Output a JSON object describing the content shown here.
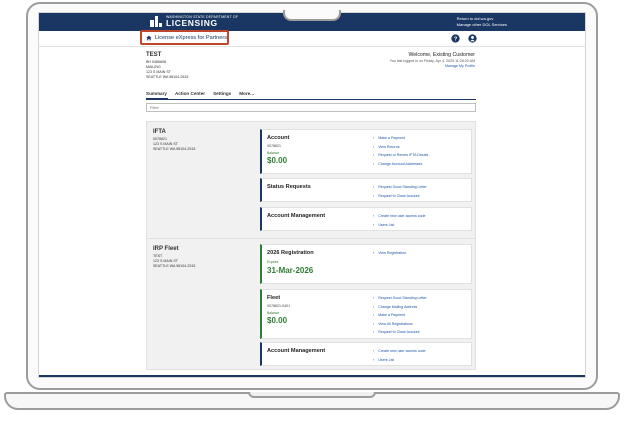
{
  "header": {
    "brand_small": "WASHINGTON STATE DEPARTMENT OF",
    "brand_big": "LICENSING",
    "link_return": "Return to dol.wa.gov",
    "link_other": "Manage other DOL Services"
  },
  "subheader": {
    "product_name": "License eXpress for Partners"
  },
  "customer": {
    "name": "TEST",
    "id": "BH 0466698",
    "line1": "MAILING",
    "line2": "123 S MAIN ST",
    "line3": "SEATTLE WA 98104-2515"
  },
  "welcome": {
    "title": "Welcome, Existing Customer",
    "last_login": "You last logged in on Friday, Apr 4, 2025 11:28:20 AM",
    "manage_profile": "Manage My Profile"
  },
  "tabs": [
    "Summary",
    "Action Center",
    "Settings",
    "More..."
  ],
  "filter": {
    "placeholder": "Filter"
  },
  "ifta": {
    "title": "IFTA",
    "id": "0078821",
    "addr1": "123 S MAIN ST",
    "addr2": "SEATTLE WA 98104-2515",
    "account": {
      "title": "Account",
      "number": "0078821",
      "balance_label": "Balance",
      "balance": "$0.00",
      "links": [
        "Make a Payment",
        "View Returns",
        "Request or Renew IFTA Decals",
        "Change Account Addresses"
      ]
    },
    "status": {
      "title": "Status Requests",
      "links": [
        "Request Good Standing Letter",
        "Request to Close Account"
      ]
    },
    "management": {
      "title": "Account Management",
      "links": [
        "Create new user access code",
        "Users List"
      ]
    }
  },
  "irp": {
    "title": "IRP Fleet",
    "line1": "TEST",
    "addr1": "123 S MAIN ST",
    "addr2": "SEATTLE WA 98104-2515",
    "registration": {
      "title": "2026 Registration",
      "expires_label": "Expires",
      "expires": "31-Mar-2026",
      "links": [
        "View Registration"
      ]
    },
    "fleet": {
      "title": "Fleet",
      "number": "0078821-0401",
      "balance_label": "Balance",
      "balance": "$0.00",
      "links": [
        "Request Good Standing Letter",
        "Change Mailing Address",
        "Make a Payment",
        "View All Registrations",
        "Request to Close Account"
      ]
    },
    "management": {
      "title": "Account Management",
      "links": [
        "Create new user access code",
        "Users List"
      ]
    }
  },
  "colors": {
    "navy": "#1a3763",
    "highlight": "#c0462a",
    "green": "#2e7d32",
    "link": "#1d55a3"
  }
}
